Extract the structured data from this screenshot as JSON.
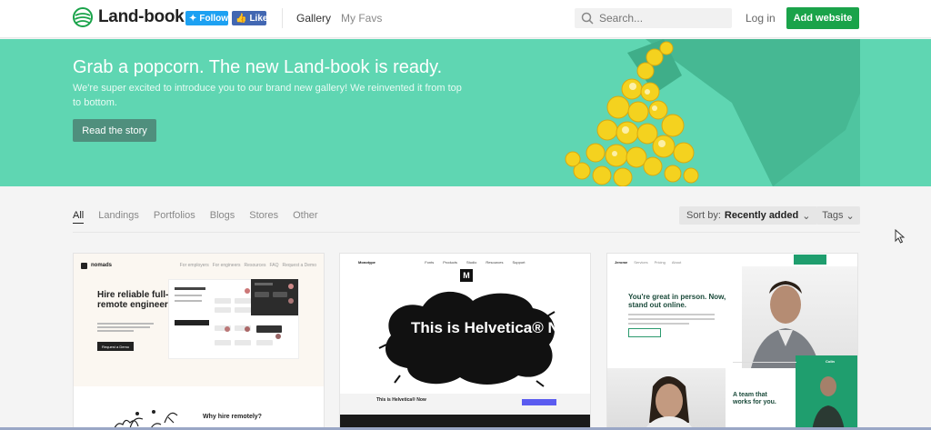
{
  "header": {
    "logo_text": "Land-book",
    "twitter_label": "Follow",
    "facebook_label": "Like",
    "nav": [
      "Gallery",
      "My Favs"
    ],
    "search_placeholder": "Search...",
    "login_label": "Log in",
    "add_website_label": "Add website"
  },
  "hero": {
    "title": "Grab a popcorn. The new Land-book is ready.",
    "subtitle": "We're super excited to introduce you to our brand new gallery! We reinvented it from top to bottom.",
    "button_label": "Read the story"
  },
  "filters": {
    "items": [
      "All",
      "Landings",
      "Portfolios",
      "Blogs",
      "Stores",
      "Other"
    ],
    "active": "All",
    "sort_prefix": "Sort by:",
    "sort_value": "Recently added",
    "tags_label": "Tags"
  },
  "cards": [
    {
      "brand": "nomads",
      "nav_items": [
        "For employers",
        "For engineers",
        "For engineers",
        "Resources",
        "FAQ",
        "Request a Demo"
      ],
      "headline": "Hire reliable full-remote engineer",
      "button": "Request a Demo",
      "section_heading": "Why hire remotely?"
    },
    {
      "brand": "Monotype",
      "nav_items": [
        "Fonts",
        "Products",
        "Studio",
        "Resources",
        "Support"
      ],
      "logo_letter": "M",
      "headline": "This is Helvetica® Now.",
      "strip_text": "This is Helvetica® Now"
    },
    {
      "brand": "Jerome",
      "nav_items": [
        "Services",
        "Pricing",
        "About"
      ],
      "headline": "You're great in person. Now, stand out online.",
      "second_heading": "A team that works for you.",
      "name_label": "Colin"
    }
  ],
  "colors": {
    "hero_bg": "#5fd6b2",
    "accent_green": "#1aa34a",
    "twitter_blue": "#1da1f2",
    "facebook_blue": "#4267b2"
  }
}
